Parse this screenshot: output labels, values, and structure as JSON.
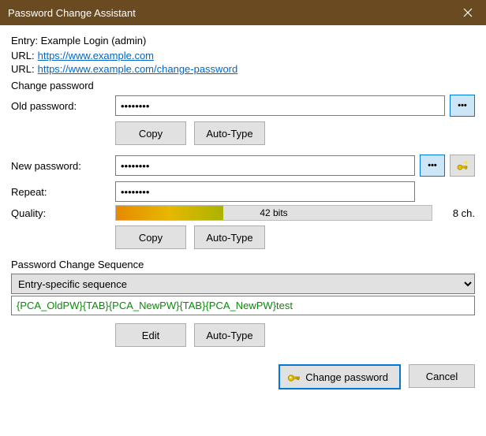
{
  "window": {
    "title": "Password Change Assistant"
  },
  "entry": {
    "label": "Entry:",
    "value": "Example Login (admin)"
  },
  "urls": {
    "label": "URL:",
    "url1": "https://www.example.com",
    "url2": "https://www.example.com/change-password"
  },
  "sections": {
    "change_pw": "Change password",
    "sequence": "Password Change Sequence"
  },
  "old_pw": {
    "label": "Old password:",
    "value": "••••••••",
    "copy": "Copy",
    "autotype": "Auto-Type"
  },
  "new_pw": {
    "label": "New password:",
    "value": "••••••••"
  },
  "repeat": {
    "label": "Repeat:",
    "value": "••••••••"
  },
  "quality": {
    "label": "Quality:",
    "bits": "42 bits",
    "chars": "8 ch.",
    "copy": "Copy",
    "autotype": "Auto-Type"
  },
  "sequence": {
    "dropdown": "Entry-specific sequence",
    "parts": {
      "t1": "{PCA_OldPW}",
      "t2": "{TAB}",
      "t3": "{PCA_NewPW}",
      "t4": "{TAB}",
      "t5": "{PCA_NewPW}",
      "tail": "test"
    },
    "edit": "Edit",
    "autotype": "Auto-Type"
  },
  "footer": {
    "change": "Change password",
    "cancel": "Cancel"
  },
  "icons": {
    "reveal": "•••"
  }
}
